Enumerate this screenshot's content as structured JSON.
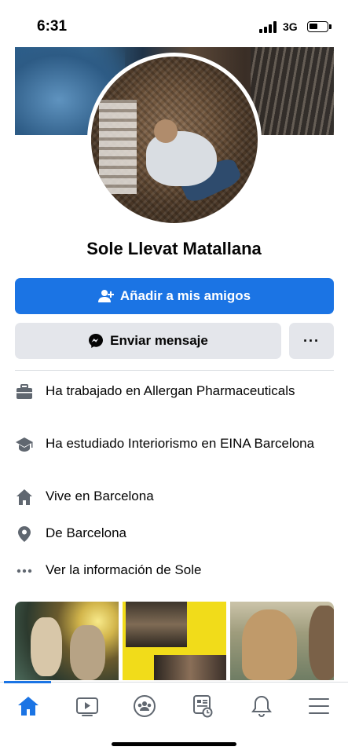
{
  "status_bar": {
    "time": "6:31",
    "network": "3G",
    "battery_level": 0.4
  },
  "profile": {
    "name": "Sole Llevat Matallana"
  },
  "actions": {
    "add_friend": "Añadir a mis amigos",
    "message": "Enviar mensaje",
    "more": "···"
  },
  "info": [
    {
      "icon": "briefcase-icon",
      "text": "Ha trabajado en Allergan Pharmaceuticals"
    },
    {
      "icon": "graduation-cap-icon",
      "text": "Ha estudiado Interiorismo en EINA Barcelona"
    },
    {
      "icon": "home-icon",
      "text": "Vive en Barcelona"
    },
    {
      "icon": "location-pin-icon",
      "text": "De Barcelona"
    },
    {
      "icon": "more-dots-icon",
      "text": "Ver la información de Sole"
    }
  ],
  "bottom_nav": [
    "home-icon",
    "video-icon",
    "groups-icon",
    "news-icon",
    "bell-icon",
    "menu-icon"
  ],
  "colors": {
    "accent": "#1b74e4",
    "secondary_button": "#e4e6eb",
    "icon_gray": "#606770"
  }
}
